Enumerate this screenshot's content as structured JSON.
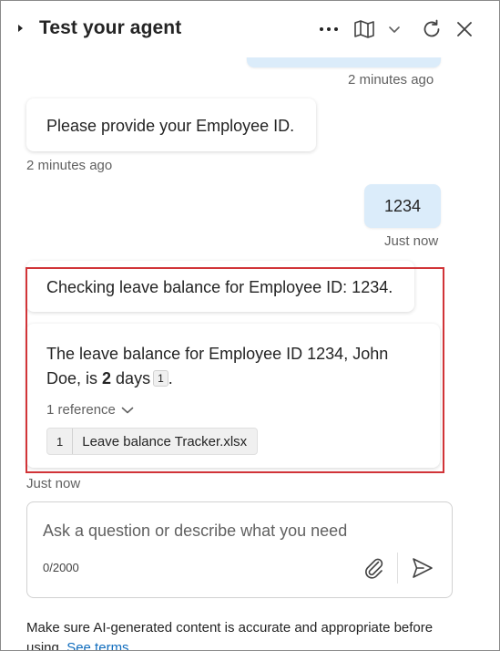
{
  "header": {
    "title": "Test your agent",
    "more_icon": "more-horizontal-icon",
    "map_icon": "map-icon",
    "dropdown_icon": "chevron-down-icon",
    "refresh_icon": "refresh-icon",
    "close_icon": "close-icon"
  },
  "messages": {
    "top_timestamp": "2 minutes ago",
    "bot_prompt": "Please provide your Employee ID.",
    "bot_prompt_timestamp": "2 minutes ago",
    "user_reply": "1234",
    "user_reply_timestamp": "Just now",
    "bot_checking": "Checking leave balance for Employee ID: 1234.",
    "bot_answer_prefix": "The leave balance for Employee ID 1234, John Doe, is ",
    "bot_answer_bold": "2",
    "bot_answer_suffix": " days",
    "bot_answer_citation": "1",
    "bot_answer_end": ".",
    "reference_toggle": "1 reference",
    "reference_number": "1",
    "reference_name": "Leave balance Tracker.xlsx",
    "bot_answer_timestamp": "Just now"
  },
  "composer": {
    "placeholder": "Ask a question or describe what you need",
    "counter": "0/2000",
    "attach_icon": "paperclip-icon",
    "send_icon": "send-icon"
  },
  "footer": {
    "disclaimer": "Make sure AI-generated content is accurate and appropriate before using.",
    "link": "See terms"
  },
  "colors": {
    "user_bubble": "#dbecfa",
    "highlight_border": "#d13438",
    "link": "#0f6cbd"
  }
}
